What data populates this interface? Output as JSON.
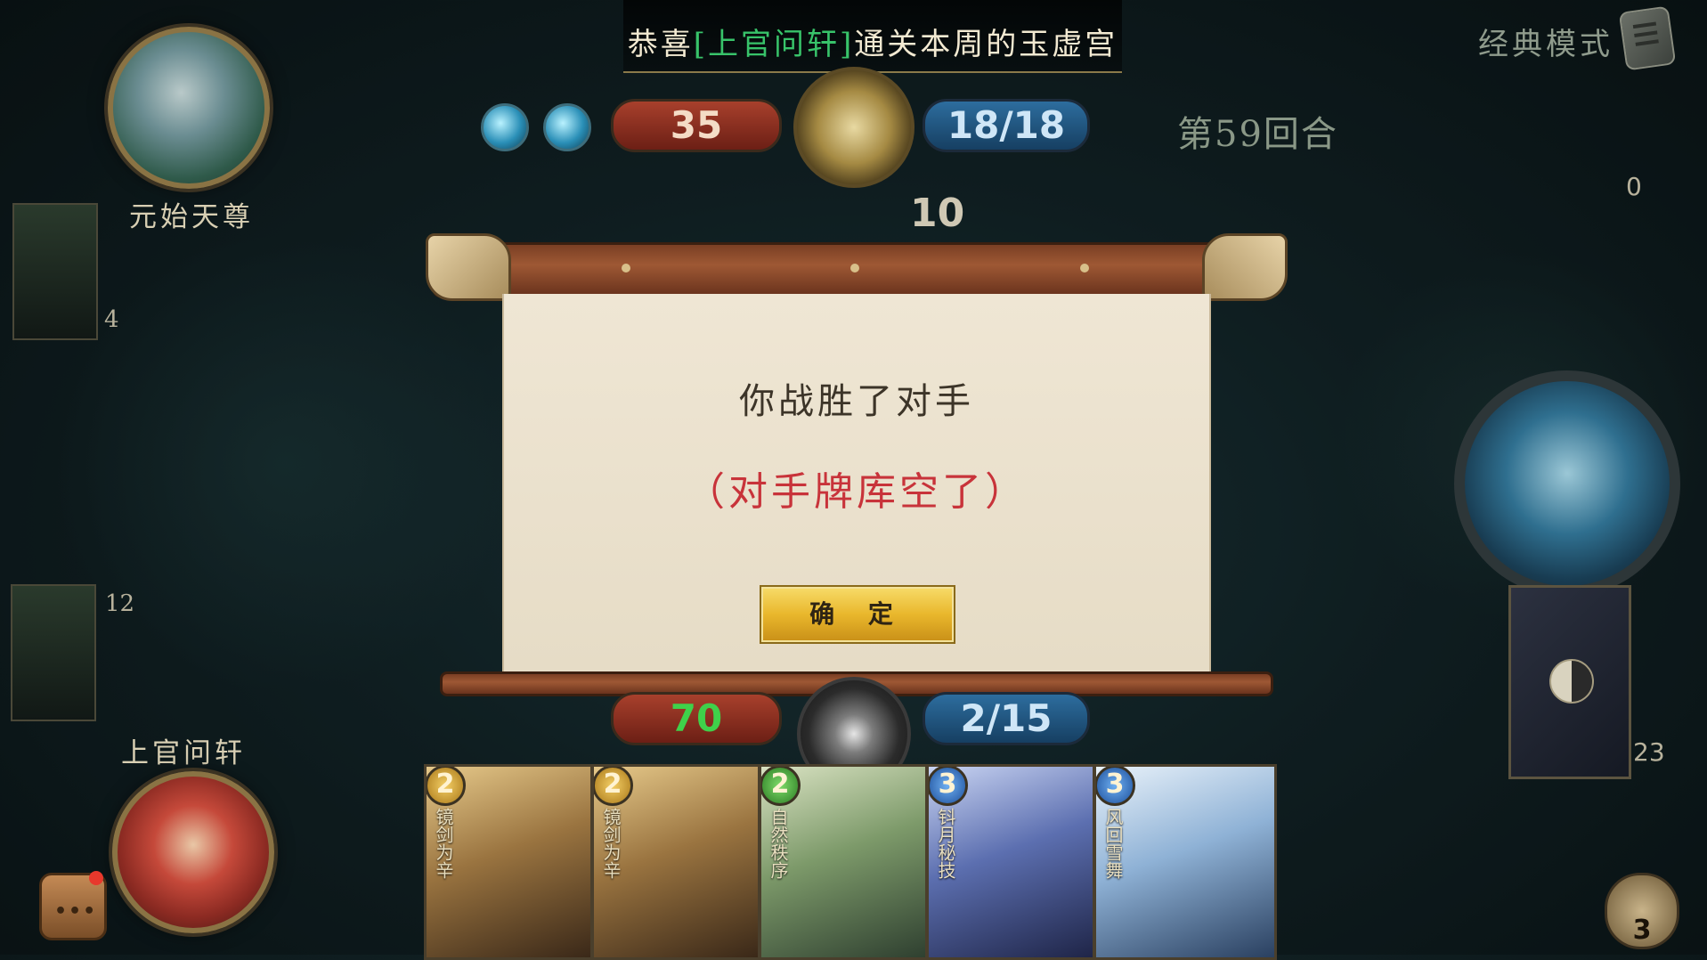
{
  "banner": {
    "prefix": "恭喜",
    "player_tag": "[上官问轩]",
    "suffix": "通关本周的玉虚宫"
  },
  "mode": {
    "label": "经典模式",
    "icon": "scroll-list-icon"
  },
  "opponent": {
    "name": "元始天尊",
    "hp": "35",
    "mana": "18/18",
    "deck_card_count": "4"
  },
  "turn": {
    "label": "第59回合"
  },
  "center_counter": "10",
  "right_top_count": "0",
  "player": {
    "name": "上官问轩",
    "hp": "70",
    "mana": "2/15",
    "side_card_count": "12",
    "deck_count": "23"
  },
  "dialog": {
    "message": "你战胜了对手",
    "reason": "（对手牌库空了）",
    "confirm_label": "确 定"
  },
  "hand": [
    {
      "cost": "2",
      "title": "镜剑为辛",
      "cost_color": "gold"
    },
    {
      "cost": "2",
      "title": "镜剑为辛",
      "cost_color": "gold"
    },
    {
      "cost": "2",
      "title": "自然秩序",
      "cost_color": "green"
    },
    {
      "cost": "3",
      "title": "钭月秘技",
      "cost_color": "blue"
    },
    {
      "cost": "3",
      "title": "风回雪舞",
      "cost_color": "blue"
    }
  ],
  "emote": {
    "count": "3"
  },
  "colors": {
    "highlight_green": "#38c36a",
    "dialog_red": "#c8333a",
    "button_gold": "#e9b72c"
  }
}
